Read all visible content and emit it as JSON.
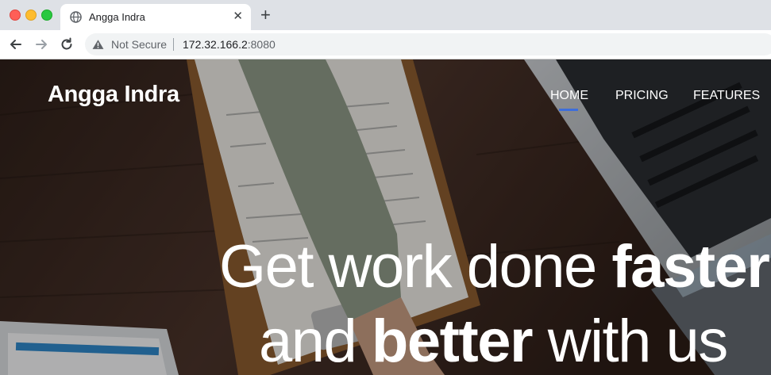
{
  "browser": {
    "tab_title": "Angga Indra",
    "tab_close": "✕",
    "new_tab": "+",
    "security_label": "Not Secure",
    "url_host": "172.32.166.2",
    "url_port": ":8080"
  },
  "site": {
    "brand": "Angga Indra",
    "nav": [
      {
        "label": "HOME",
        "active": true
      },
      {
        "label": "PRICING",
        "active": false
      },
      {
        "label": "FEATURES",
        "active": false
      }
    ],
    "headline": {
      "line1_light": "Get work done ",
      "line1_bold": "faster",
      "line2_light_a": "and ",
      "line2_bold": "better",
      "line2_light_b": " with us"
    },
    "accent_color": "#3d6edb"
  }
}
